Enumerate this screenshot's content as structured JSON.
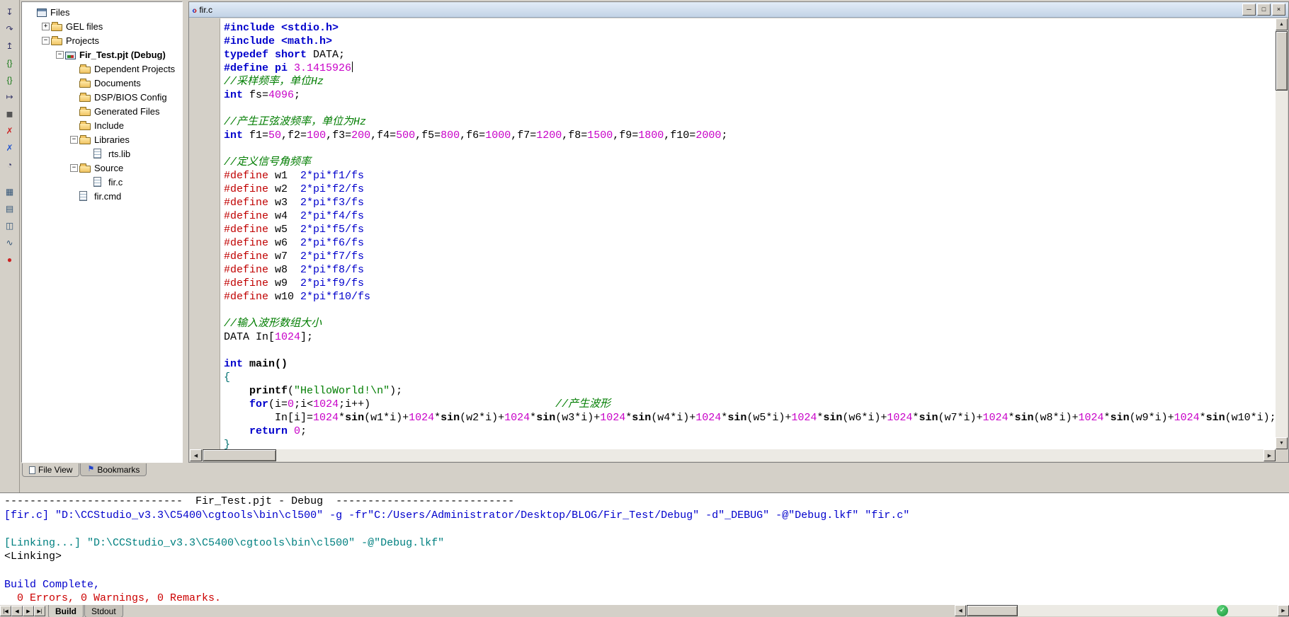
{
  "colors": {
    "keyword_blue": "#0000cc",
    "number_magenta": "#c800c8",
    "comment_green": "#007d00",
    "define_red": "#c00000",
    "string_green": "#007d00",
    "brace_teal": "#007070",
    "build_command_blue": "#0000cc",
    "build_link_teal": "#008080",
    "build_error_red": "#cc0000"
  },
  "icons": {
    "scroll_up": "▲",
    "scroll_down": "▼",
    "scroll_left": "◀",
    "scroll_right": "▶",
    "nav_first": "|◀",
    "nav_prev": "◀",
    "nav_next": "▶",
    "nav_last": "▶|",
    "minimize": "─",
    "restore": "□",
    "close": "×",
    "file_bracket_left": "‹",
    "file_bracket_right": "›",
    "bookmark_flag": "⚑",
    "overlay_check": "✓"
  },
  "left_toolbar": {
    "icons": [
      {
        "name": "step-into-icon",
        "glyph": "↧",
        "color": "#333366"
      },
      {
        "name": "step-over-icon",
        "glyph": "↷",
        "color": "#333366"
      },
      {
        "name": "step-out-icon",
        "glyph": "↥",
        "color": "#333366"
      },
      {
        "name": "run-icon",
        "glyph": "{}",
        "color": "#1a7a1a"
      },
      {
        "name": "animate-icon",
        "glyph": "{}",
        "color": "#1a7a1a"
      },
      {
        "name": "run-to-cursor-icon",
        "glyph": "↦",
        "color": "#333366"
      },
      {
        "name": "halt-icon",
        "glyph": "◼",
        "color": "#555555"
      },
      {
        "name": "remove-breakpoints-icon",
        "glyph": "✗",
        "color": "#cc2222"
      },
      {
        "name": "remove-probepoints-icon",
        "glyph": "✗",
        "color": "#2255cc"
      },
      {
        "name": "profile-clock-icon",
        "glyph": "◔",
        "color": "#333366"
      },
      {
        "name": "memory-window-icon",
        "glyph": "▦",
        "color": "#335577",
        "gap": true
      },
      {
        "name": "register-window-icon",
        "glyph": "▤",
        "color": "#335577"
      },
      {
        "name": "watch-window-icon",
        "glyph": "◫",
        "color": "#335577"
      },
      {
        "name": "graph-window-icon",
        "glyph": "∿",
        "color": "#335577"
      },
      {
        "name": "record-icon",
        "glyph": "●",
        "color": "#cc2222"
      }
    ]
  },
  "tree": {
    "rows": [
      {
        "label": "Files",
        "level": 0,
        "icon": "root",
        "expander": null,
        "bold": false
      },
      {
        "label": "GEL files",
        "level": 1,
        "icon": "folder",
        "expander": "plus",
        "bold": false
      },
      {
        "label": "Projects",
        "level": 1,
        "icon": "folder",
        "expander": "minus",
        "bold": false
      },
      {
        "label": "Fir_Test.pjt (Debug)",
        "level": 2,
        "icon": "project",
        "expander": "minus",
        "bold": true
      },
      {
        "label": "Dependent Projects",
        "level": 3,
        "icon": "folder",
        "expander": null,
        "bold": false
      },
      {
        "label": "Documents",
        "level": 3,
        "icon": "folder",
        "expander": null,
        "bold": false
      },
      {
        "label": "DSP/BIOS Config",
        "level": 3,
        "icon": "folder",
        "expander": null,
        "bold": false
      },
      {
        "label": "Generated Files",
        "level": 3,
        "icon": "folder",
        "expander": null,
        "bold": false
      },
      {
        "label": "Include",
        "level": 3,
        "icon": "folder",
        "expander": null,
        "bold": false
      },
      {
        "label": "Libraries",
        "level": 3,
        "icon": "folder",
        "expander": "minus",
        "bold": false
      },
      {
        "label": "rts.lib",
        "level": 4,
        "icon": "doc",
        "expander": null,
        "bold": false
      },
      {
        "label": "Source",
        "level": 3,
        "icon": "folder",
        "expander": "minus",
        "bold": false
      },
      {
        "label": "fir.c",
        "level": 4,
        "icon": "doc",
        "expander": null,
        "bold": false
      },
      {
        "label": "fir.cmd",
        "level": 3,
        "icon": "doc",
        "expander": null,
        "bold": false
      }
    ],
    "tabs": [
      {
        "label": "File View",
        "icon": "page",
        "active": true,
        "bold": false
      },
      {
        "label": "Bookmarks",
        "icon": "flag",
        "active": false,
        "bold": false
      }
    ]
  },
  "editor": {
    "title": "fir.c",
    "code_lines": [
      [
        {
          "t": "#include <stdio.h>",
          "s": "kw"
        }
      ],
      [
        {
          "t": "#include <math.h>",
          "s": "kw"
        }
      ],
      [
        {
          "t": "typedef short",
          "s": "kw"
        },
        {
          "t": " DATA;",
          "s": "id"
        }
      ],
      [
        {
          "t": "#define pi ",
          "s": "kw"
        },
        {
          "t": "3.1415926",
          "s": "num"
        },
        {
          "t": "",
          "s": "caret"
        }
      ],
      [
        {
          "t": "//采样频率，单位Hz",
          "s": "cmt"
        }
      ],
      [
        {
          "t": "int",
          "s": "kw"
        },
        {
          "t": " fs=",
          "s": "id"
        },
        {
          "t": "4096",
          "s": "num"
        },
        {
          "t": ";",
          "s": "id"
        }
      ],
      [],
      [
        {
          "t": "//产生正弦波频率，单位为Hz",
          "s": "cmt"
        }
      ],
      [
        {
          "t": "int",
          "s": "kw"
        },
        {
          "t": " f1=",
          "s": "id"
        },
        {
          "t": "50",
          "s": "num"
        },
        {
          "t": ",f2=",
          "s": "id"
        },
        {
          "t": "100",
          "s": "num"
        },
        {
          "t": ",f3=",
          "s": "id"
        },
        {
          "t": "200",
          "s": "num"
        },
        {
          "t": ",f4=",
          "s": "id"
        },
        {
          "t": "500",
          "s": "num"
        },
        {
          "t": ",f5=",
          "s": "id"
        },
        {
          "t": "800",
          "s": "num"
        },
        {
          "t": ",f6=",
          "s": "id"
        },
        {
          "t": "1000",
          "s": "num"
        },
        {
          "t": ",f7=",
          "s": "id"
        },
        {
          "t": "1200",
          "s": "num"
        },
        {
          "t": ",f8=",
          "s": "id"
        },
        {
          "t": "1500",
          "s": "num"
        },
        {
          "t": ",f9=",
          "s": "id"
        },
        {
          "t": "1800",
          "s": "num"
        },
        {
          "t": ",f10=",
          "s": "id"
        },
        {
          "t": "2000",
          "s": "num"
        },
        {
          "t": ";",
          "s": "id"
        }
      ],
      [],
      [
        {
          "t": "//定义信号角频率",
          "s": "cmt"
        }
      ],
      [
        {
          "t": "#define",
          "s": "def"
        },
        {
          "t": " w1  ",
          "s": "id"
        },
        {
          "t": "2*pi*f1/fs",
          "s": "expr"
        }
      ],
      [
        {
          "t": "#define",
          "s": "def"
        },
        {
          "t": " w2  ",
          "s": "id"
        },
        {
          "t": "2*pi*f2/fs",
          "s": "expr"
        }
      ],
      [
        {
          "t": "#define",
          "s": "def"
        },
        {
          "t": " w3  ",
          "s": "id"
        },
        {
          "t": "2*pi*f3/fs",
          "s": "expr"
        }
      ],
      [
        {
          "t": "#define",
          "s": "def"
        },
        {
          "t": " w4  ",
          "s": "id"
        },
        {
          "t": "2*pi*f4/fs",
          "s": "expr"
        }
      ],
      [
        {
          "t": "#define",
          "s": "def"
        },
        {
          "t": " w5  ",
          "s": "id"
        },
        {
          "t": "2*pi*f5/fs",
          "s": "expr"
        }
      ],
      [
        {
          "t": "#define",
          "s": "def"
        },
        {
          "t": " w6  ",
          "s": "id"
        },
        {
          "t": "2*pi*f6/fs",
          "s": "expr"
        }
      ],
      [
        {
          "t": "#define",
          "s": "def"
        },
        {
          "t": " w7  ",
          "s": "id"
        },
        {
          "t": "2*pi*f7/fs",
          "s": "expr"
        }
      ],
      [
        {
          "t": "#define",
          "s": "def"
        },
        {
          "t": " w8  ",
          "s": "id"
        },
        {
          "t": "2*pi*f8/fs",
          "s": "expr"
        }
      ],
      [
        {
          "t": "#define",
          "s": "def"
        },
        {
          "t": " w9  ",
          "s": "id"
        },
        {
          "t": "2*pi*f9/fs",
          "s": "expr"
        }
      ],
      [
        {
          "t": "#define",
          "s": "def"
        },
        {
          "t": " w10 ",
          "s": "id"
        },
        {
          "t": "2*pi*f10/fs",
          "s": "expr"
        }
      ],
      [],
      [
        {
          "t": "//输入波形数组大小",
          "s": "cmt"
        }
      ],
      [
        {
          "t": "DATA In[",
          "s": "id"
        },
        {
          "t": "1024",
          "s": "num"
        },
        {
          "t": "];",
          "s": "id"
        }
      ],
      [],
      [
        {
          "t": "int",
          "s": "kw"
        },
        {
          "t": " ",
          "s": "id"
        },
        {
          "t": "main()",
          "s": "bold"
        }
      ],
      [
        {
          "t": "{",
          "s": "brace"
        }
      ],
      [
        {
          "t": "    ",
          "s": "id"
        },
        {
          "t": "printf",
          "s": "bold"
        },
        {
          "t": "(",
          "s": "id"
        },
        {
          "t": "\"HelloWorld!\\n\"",
          "s": "str"
        },
        {
          "t": ");",
          "s": "id"
        }
      ],
      [
        {
          "t": "    ",
          "s": "id"
        },
        {
          "t": "for",
          "s": "kw"
        },
        {
          "t": "(i=",
          "s": "id"
        },
        {
          "t": "0",
          "s": "num"
        },
        {
          "t": ";i<",
          "s": "id"
        },
        {
          "t": "1024",
          "s": "num"
        },
        {
          "t": ";i++)",
          "s": "id"
        },
        {
          "t": "                             ",
          "s": "id"
        },
        {
          "t": "//产生波形",
          "s": "cmt"
        }
      ],
      [
        {
          "t": "        In[i]=",
          "s": "id"
        },
        {
          "t": "1024",
          "s": "num"
        },
        {
          "t": "*",
          "s": "id"
        },
        {
          "t": "sin",
          "s": "bold"
        },
        {
          "t": "(w1*i)+",
          "s": "id"
        },
        {
          "t": "1024",
          "s": "num"
        },
        {
          "t": "*",
          "s": "id"
        },
        {
          "t": "sin",
          "s": "bold"
        },
        {
          "t": "(w2*i)+",
          "s": "id"
        },
        {
          "t": "1024",
          "s": "num"
        },
        {
          "t": "*",
          "s": "id"
        },
        {
          "t": "sin",
          "s": "bold"
        },
        {
          "t": "(w3*i)+",
          "s": "id"
        },
        {
          "t": "1024",
          "s": "num"
        },
        {
          "t": "*",
          "s": "id"
        },
        {
          "t": "sin",
          "s": "bold"
        },
        {
          "t": "(w4*i)+",
          "s": "id"
        },
        {
          "t": "1024",
          "s": "num"
        },
        {
          "t": "*",
          "s": "id"
        },
        {
          "t": "sin",
          "s": "bold"
        },
        {
          "t": "(w5*i)+",
          "s": "id"
        },
        {
          "t": "1024",
          "s": "num"
        },
        {
          "t": "*",
          "s": "id"
        },
        {
          "t": "sin",
          "s": "bold"
        },
        {
          "t": "(w6*i)+",
          "s": "id"
        },
        {
          "t": "1024",
          "s": "num"
        },
        {
          "t": "*",
          "s": "id"
        },
        {
          "t": "sin",
          "s": "bold"
        },
        {
          "t": "(w7*i)+",
          "s": "id"
        },
        {
          "t": "1024",
          "s": "num"
        },
        {
          "t": "*",
          "s": "id"
        },
        {
          "t": "sin",
          "s": "bold"
        },
        {
          "t": "(w8*i)+",
          "s": "id"
        },
        {
          "t": "1024",
          "s": "num"
        },
        {
          "t": "*",
          "s": "id"
        },
        {
          "t": "sin",
          "s": "bold"
        },
        {
          "t": "(w9*i)+",
          "s": "id"
        },
        {
          "t": "1024",
          "s": "num"
        },
        {
          "t": "*",
          "s": "id"
        },
        {
          "t": "sin",
          "s": "bold"
        },
        {
          "t": "(w10*i);",
          "s": "id"
        }
      ],
      [
        {
          "t": "    ",
          "s": "id"
        },
        {
          "t": "return",
          "s": "kw"
        },
        {
          "t": " ",
          "s": "id"
        },
        {
          "t": "0",
          "s": "num"
        },
        {
          "t": ";",
          "s": "id"
        }
      ],
      [
        {
          "t": "}",
          "s": "brace"
        }
      ]
    ]
  },
  "build": {
    "lines": [
      {
        "text": "----------------------------  Fir_Test.pjt - Debug  ----------------------------",
        "color": "default"
      },
      {
        "text": "[fir.c] \"D:\\CCStudio_v3.3\\C5400\\cgtools\\bin\\cl500\" -g -fr\"C:/Users/Administrator/Desktop/BLOG/Fir_Test/Debug\" -d\"_DEBUG\" -@\"Debug.lkf\" \"fir.c\"",
        "color": "blue"
      },
      {
        "text": "",
        "color": "default"
      },
      {
        "text": "[Linking...] \"D:\\CCStudio_v3.3\\C5400\\cgtools\\bin\\cl500\" -@\"Debug.lkf\"",
        "color": "teal"
      },
      {
        "text": "<Linking>",
        "color": "default"
      },
      {
        "text": "",
        "color": "default"
      },
      {
        "text": "Build Complete,",
        "color": "blue"
      },
      {
        "text": "  0 Errors, 0 Warnings, 0 Remarks.",
        "color": "red"
      }
    ],
    "tabs": [
      {
        "label": "Build",
        "active": true,
        "bold": true
      },
      {
        "label": "Stdout",
        "active": false,
        "bold": false
      }
    ]
  }
}
